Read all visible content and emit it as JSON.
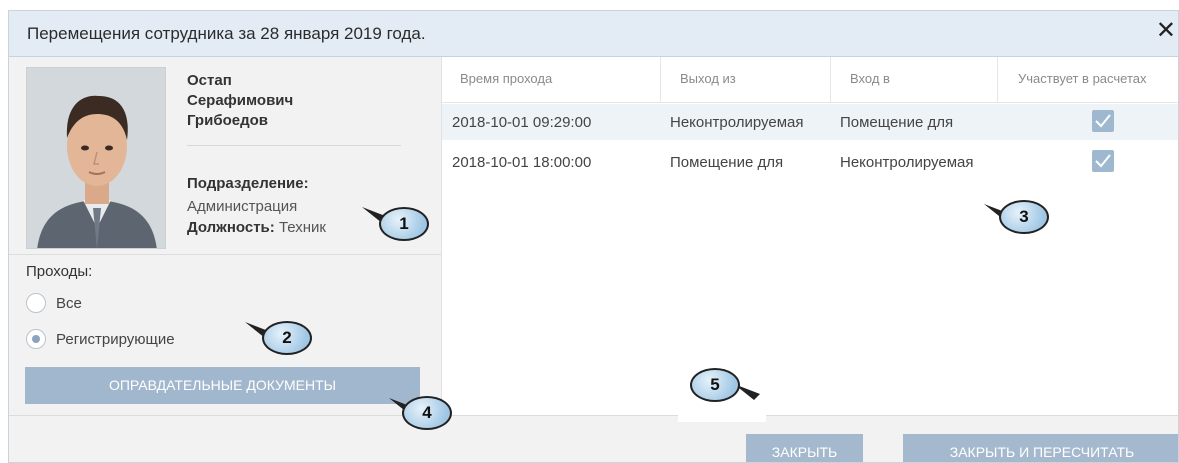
{
  "dialog": {
    "title": "Перемещения сотрудника за 28 января 2019 года.",
    "close_glyph": "✕"
  },
  "employee": {
    "first_name": "Остап",
    "middle_name": "Серафимович",
    "last_name": "Грибоедов",
    "department_label": "Подразделение:",
    "department_value": "Администрация",
    "position_label": "Должность:",
    "position_value": "Техник"
  },
  "filter": {
    "label": "Проходы:",
    "options": [
      {
        "label": "Все",
        "selected": false
      },
      {
        "label": "Регистрирующие",
        "selected": true
      }
    ]
  },
  "docs_button": "ОПРАВДАТЕЛЬНЫЕ ДОКУМЕНТЫ",
  "table": {
    "columns": [
      "Время прохода",
      "Выход из",
      "Вход в",
      "Участвует в расчетах"
    ],
    "rows": [
      {
        "time": "2018-10-01 09:29:00",
        "exit": "Неконтролируемая",
        "entry": "Помещение для",
        "counted": true
      },
      {
        "time": "2018-10-01 18:00:00",
        "exit": "Помещение для",
        "entry": "Неконтролируемая",
        "counted": true
      }
    ]
  },
  "footer": {
    "close_button": "ЗАКРЫТЬ",
    "recalc_button": "ЗАКРЫТЬ И ПЕРЕСЧИТАТЬ"
  },
  "callouts": [
    "1",
    "2",
    "3",
    "4",
    "5"
  ],
  "colors": {
    "header_bg": "#e3ecf5",
    "button_bg": "#a4b9ce",
    "checkbox": "#9eb8d0",
    "callout_fill": "#9fc6e4"
  }
}
